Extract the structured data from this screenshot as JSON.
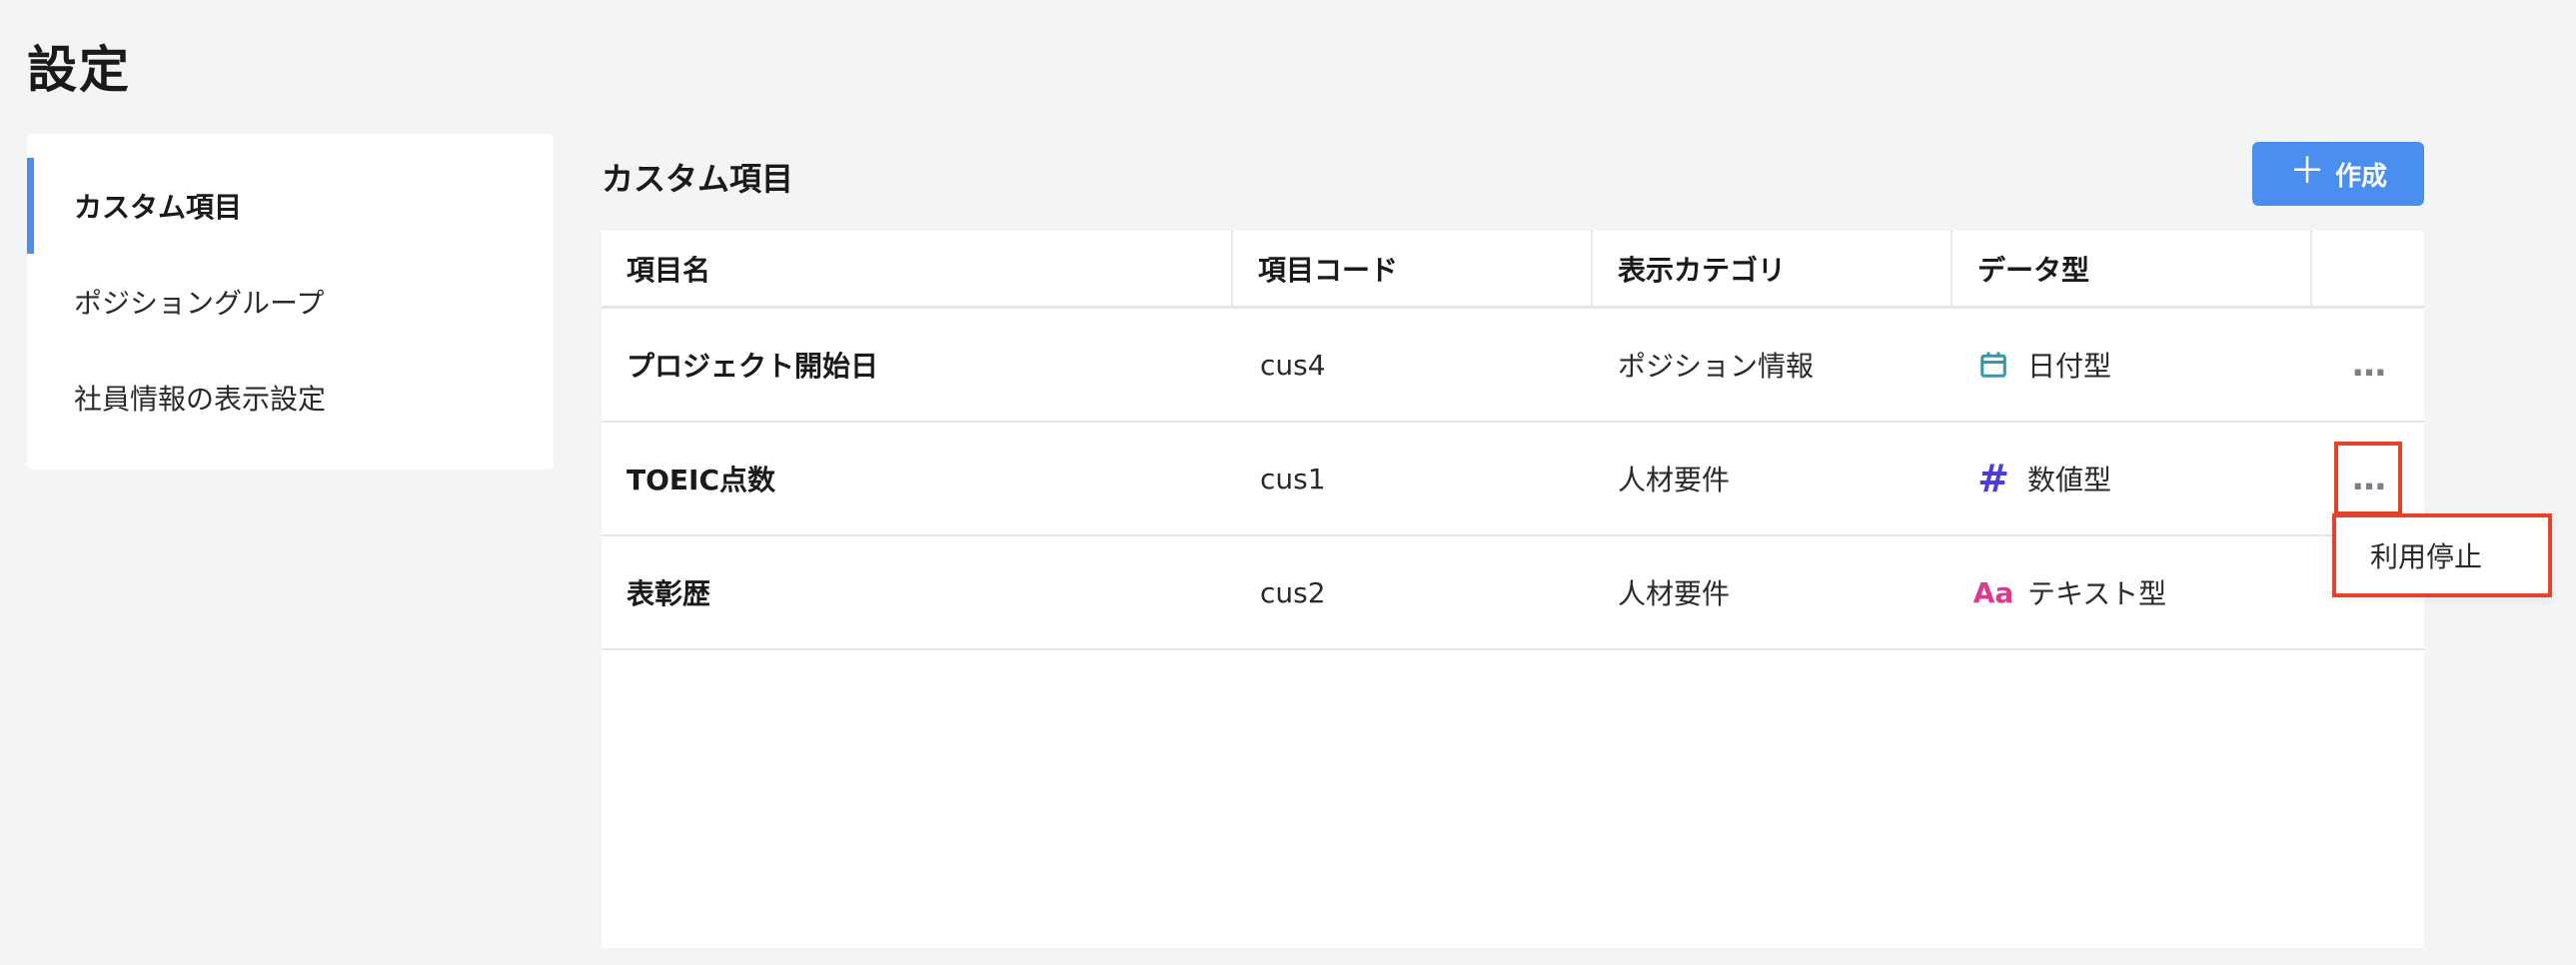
{
  "page": {
    "title": "設定"
  },
  "sidebar": {
    "items": [
      {
        "label": "カスタム項目",
        "active": true
      },
      {
        "label": "ポジショングループ",
        "active": false
      },
      {
        "label": "社員情報の表示設定",
        "active": false
      }
    ]
  },
  "main": {
    "title": "カスタム項目",
    "create_button": {
      "icon": "plus-icon",
      "label": "作成"
    },
    "table": {
      "columns": [
        "項目名",
        "項目コード",
        "表示カテゴリ",
        "データ型",
        ""
      ],
      "rows": [
        {
          "name": "プロジェクト開始日",
          "code": "cus4",
          "category": "ポジション情報",
          "type_icon": "calendar-icon",
          "type": "日付型"
        },
        {
          "name": "TOEIC点数",
          "code": "cus1",
          "category": "人材要件",
          "type_icon": "hash-icon",
          "type": "数値型"
        },
        {
          "name": "表彰歴",
          "code": "cus2",
          "category": "人材要件",
          "type_icon": "text-aa-icon",
          "type": "テキスト型"
        }
      ]
    },
    "row_menu": {
      "items": [
        "利用停止"
      ]
    }
  },
  "icons": {
    "more": "…",
    "hash": "#",
    "text": "Aa"
  },
  "colors": {
    "accent": "#4a8ff0",
    "highlight": "#e2432a",
    "calendar_icon": "#2f9aa8",
    "number_icon": "#4b3fd8",
    "text_icon": "#d63b8c"
  }
}
